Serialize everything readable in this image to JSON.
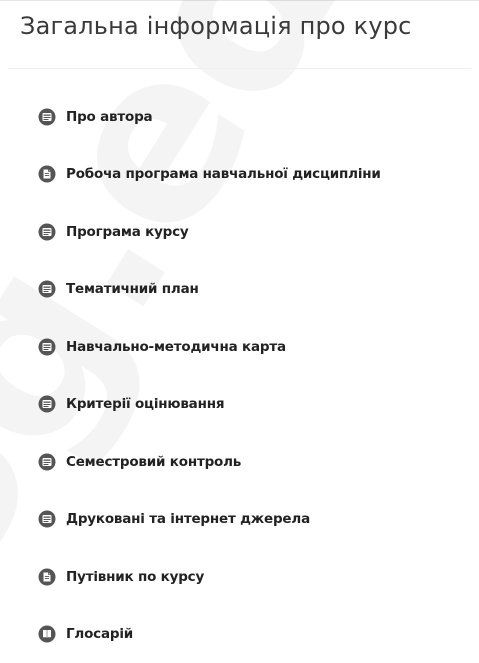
{
  "section": {
    "title": "Загальна інформація про курс"
  },
  "watermark": {
    "text": "og.edu"
  },
  "items": [
    {
      "label": "Про автора",
      "icon": "page-icon"
    },
    {
      "label": "Робоча програма навчальної дисципліни",
      "icon": "file-icon"
    },
    {
      "label": "Програма курсу",
      "icon": "page-icon"
    },
    {
      "label": "Тематичний план",
      "icon": "page-icon"
    },
    {
      "label": "Навчально-методична карта",
      "icon": "page-icon"
    },
    {
      "label": "Критерії оцінювання",
      "icon": "page-icon"
    },
    {
      "label": "Семестровий контроль",
      "icon": "page-icon"
    },
    {
      "label": "Друковані та інтернет джерела",
      "icon": "page-icon"
    },
    {
      "label": "Путівник по курсу",
      "icon": "file-icon"
    },
    {
      "label": "Глосарій",
      "icon": "glossary-icon"
    }
  ],
  "colors": {
    "icon": "#555555",
    "icon_detail": "#ffffff",
    "text": "#222222",
    "title": "#3a3a3a"
  }
}
